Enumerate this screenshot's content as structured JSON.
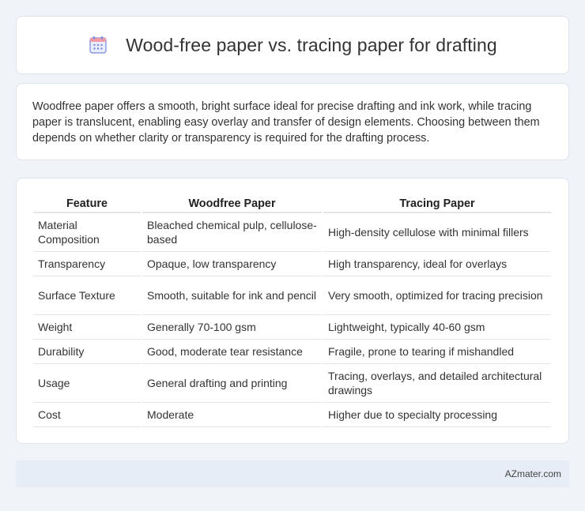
{
  "header": {
    "title": "Wood-free paper vs. tracing paper for drafting",
    "icon": "calendar-icon",
    "icon_color": "#7b8bd8"
  },
  "description": {
    "text": "Woodfree paper offers a smooth, bright surface ideal for precise drafting and ink work, while tracing paper is translucent, enabling easy overlay and transfer of design elements. Choosing between them depends on whether clarity or transparency is required for the drafting process."
  },
  "table": {
    "columns": [
      "Feature",
      "Woodfree Paper",
      "Tracing Paper"
    ],
    "rows": [
      [
        "Material Composition",
        "Bleached chemical pulp, cellulose-based",
        "High-density cellulose with minimal fillers"
      ],
      [
        "Transparency",
        "Opaque, low transparency",
        "High transparency, ideal for overlays"
      ],
      [
        "Surface Texture",
        "Smooth, suitable for ink and pencil",
        "Very smooth, optimized for tracing precision"
      ],
      [
        "Weight",
        "Generally 70-100 gsm",
        "Lightweight, typically 40-60 gsm"
      ],
      [
        "Durability",
        "Good, moderate tear resistance",
        "Fragile, prone to tearing if mishandled"
      ],
      [
        "Usage",
        "General drafting and printing",
        "Tracing, overlays, and detailed architectural drawings"
      ],
      [
        "Cost",
        "Moderate",
        "Higher due to specialty processing"
      ]
    ]
  },
  "footer": {
    "text": "AZmater.com"
  },
  "colors": {
    "background": "#f0f3f8",
    "card": "#ffffff",
    "footer_bg": "#e6edf7",
    "border": "#e2e5ea"
  }
}
